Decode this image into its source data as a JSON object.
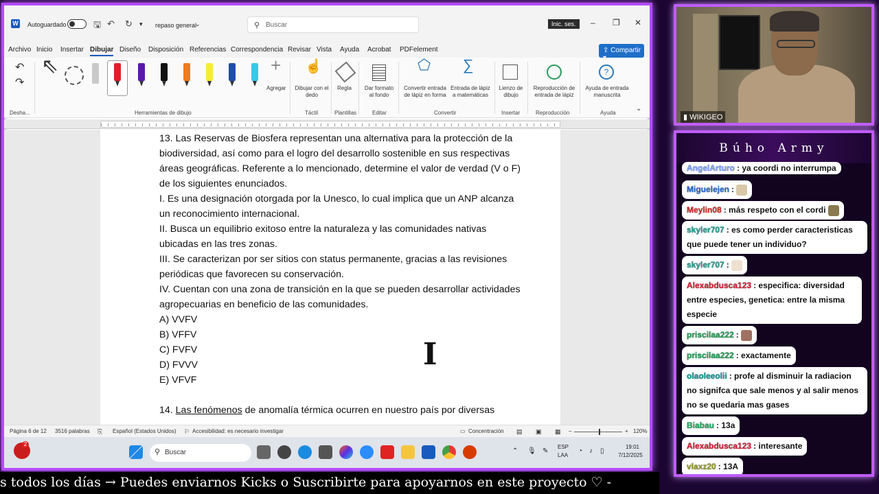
{
  "word": {
    "autosave_label": "Autoguardado",
    "doc_title": "repaso general",
    "search_placeholder": "Buscar",
    "signin": "Inic. ses.",
    "menu": [
      "Archivo",
      "Inicio",
      "Insertar",
      "Dibujar",
      "Diseño",
      "Disposición",
      "Referencias",
      "Correspondencia",
      "Revisar",
      "Vista",
      "Ayuda",
      "Acrobat",
      "PDFelement"
    ],
    "active_menu": "Dibujar",
    "share_label": "Compartir",
    "ribbon": {
      "undo_group": "Desha...",
      "drawing_tools_group": "Herramientas de dibujo",
      "add_label": "Agregar",
      "draw_finger": "Dibujar con el dedo",
      "ruler": "Regla",
      "format_bg": "Dar formato al fondo",
      "ink_to_shape": "Convertir entrada de lápiz en forma",
      "ink_math": "Entrada de lápiz a matemáticas",
      "canvas": "Lienzo de dibujo",
      "replay": "Reproducción de entrada de lápiz",
      "help": "Ayuda de entrada manuscrita",
      "groups": [
        "Táctil",
        "Plantillas",
        "Editar",
        "Convertir",
        "Insertar",
        "Reproducción",
        "Ayuda"
      ]
    },
    "document_lines": [
      "13. Las Reservas de Biosfera representan una alternativa para la protección de la",
      "biodiversidad, así como para el logro del desarrollo sostenible en sus respectivas",
      "áreas geográficas. Referente a lo mencionado, determine el valor de verdad (V o F)",
      "de los siguientes enunciados.",
      "I. Es una designación otorgada por la Unesco, lo cual implica que un ANP alcanza",
      "un reconocimiento internacional.",
      "II. Busca un equilibrio exitoso entre la naturaleza y las comunidades nativas",
      "ubicadas en las tres zonas.",
      "III. Se caracterizan por ser sitios con status permanente, gracias a las revisiones",
      "periódicas que favorecen su conservación.",
      "IV. Cuentan con una zona de transición en la que se pueden desarrollar actividades",
      "agropecuarias en beneficio de las comunidades.",
      "A) VVFV",
      "B) VFFV",
      "C) FVFV",
      "D) FVVV",
      "E) VFVF"
    ],
    "q14_prefix": "14. ",
    "q14_underlined": "Las fenómenos",
    "q14_rest": " de anomalía térmica ocurren en nuestro país por diversas",
    "status": {
      "page": "Página 6 de 12",
      "words": "3516 palabras",
      "language": "Español (Estados Unidos)",
      "accessibility": "Accesibilidad: es necesario investigar",
      "focus": "Concentración",
      "zoom": "120%"
    }
  },
  "taskbar": {
    "search": "Buscar",
    "lang": "ESP",
    "layout": "LAA",
    "time": "19:01",
    "date": "7/12/2025",
    "badge": "2"
  },
  "ticker": "s todos los días  →  Puedes enviarnos Kicks o Suscribirte para apoyarnos en este proyecto  ♡  -",
  "webcam": {
    "tag": "WIKIGEO"
  },
  "chat": {
    "title": "Búho Army",
    "messages": [
      {
        "user": "AngelArturo",
        "text": ": ya coordi no interrumpa",
        "color": "#7fa8ff"
      },
      {
        "user": "Miguelejen",
        "text": ":",
        "color": "#2f6fd8",
        "emote": "#d8c8a8"
      },
      {
        "user": "Meylin08",
        "text": ": más respeto con el cordi",
        "color": "#e03030",
        "emote": "#8a7a50"
      },
      {
        "user": "skyler707",
        "text": ": es como perder caracteristicas que puede tener un individuo?",
        "color": "#2aa198"
      },
      {
        "user": "skyler707",
        "text": ":",
        "color": "#2aa198",
        "emote": "#f0e0d0"
      },
      {
        "user": "Alexabdusca123",
        "text": ": especifica: diversidad entre especies, genetica: entre la misma especie",
        "color": "#e0243a"
      },
      {
        "user": "priscilaa222",
        "text": ":",
        "color": "#27a55a",
        "emote": "#a07060"
      },
      {
        "user": "priscilaa222",
        "text": ": exactamente",
        "color": "#27a55a"
      },
      {
        "user": "olaoleeolii",
        "text": ": profe al disminuir la radiacion no signifca que sale menos y al salir menos no se quedaria mas gases",
        "color": "#10a0a0"
      },
      {
        "user": "Biabau",
        "text": ": 13a",
        "color": "#20b060"
      },
      {
        "user": "Alexabdusca123",
        "text": ": interesante",
        "color": "#e0243a"
      },
      {
        "user": "vlaxz20",
        "text": ": 13A",
        "color": "#9aa030"
      }
    ]
  }
}
